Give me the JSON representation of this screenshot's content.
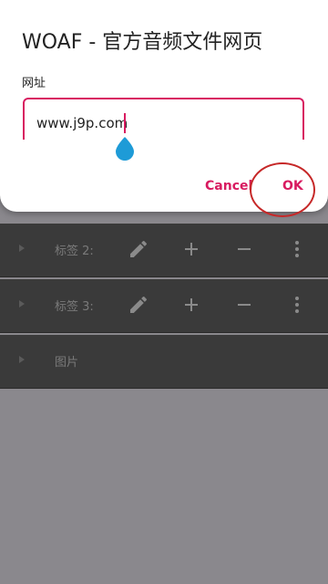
{
  "dialog": {
    "title": "WOAF - 官方音频文件网页",
    "field_label": "网址",
    "input_value": "www.j9p.com",
    "cancel_label": "Cancel",
    "ok_label": "OK"
  },
  "list": {
    "items": [
      {
        "label": "标签 2:"
      },
      {
        "label": "标签 3:"
      },
      {
        "label": "图片"
      }
    ]
  },
  "colors": {
    "accent": "#d81b60",
    "annotation": "#c62828",
    "list_bg": "#3a3a3a",
    "backdrop": "#8a888d"
  }
}
